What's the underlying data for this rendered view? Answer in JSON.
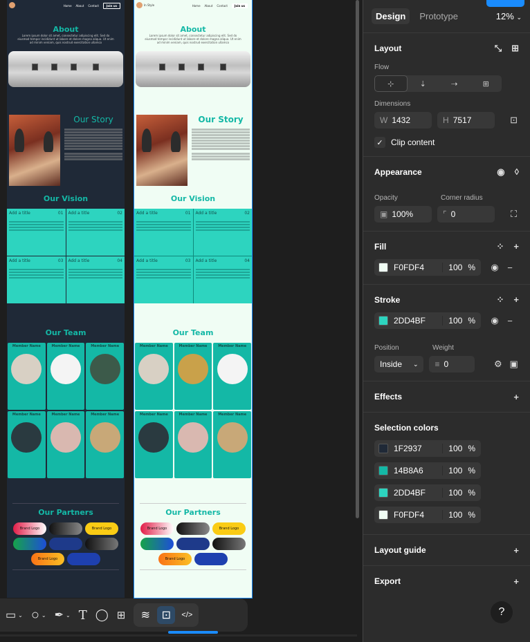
{
  "frames": [
    {
      "nav": [
        "Home",
        "About",
        "Contact"
      ],
      "join_label": "Join us",
      "about_title": "About",
      "about_text": "Lorem ipsum dolor sit amet, consectetur adipiscing elit. Sed do eiusmod tempor incididunt ut labore et dolore magna aliqua. Ut enim ad minim veniam, quis nostrud exercitation ullamco",
      "story_title": "Our Story",
      "vision_title": "Our Vision",
      "vision_cards": [
        {
          "title": "Add a title",
          "num": "01"
        },
        {
          "title": "Add a title",
          "num": "02"
        },
        {
          "title": "Add a title",
          "num": "03"
        },
        {
          "title": "Add a title",
          "num": "04"
        }
      ],
      "team_title": "Our Team",
      "member_name": "Member Name",
      "partners_title": "Our Partners",
      "brand_logo": "Brand Logo",
      "bg": "#1f2937"
    },
    {
      "brand": "In Style",
      "nav": [
        "Home",
        "About",
        "Contact"
      ],
      "join_label": "Join us",
      "about_title": "About",
      "about_text": "Lorem ipsum dolor sit amet, consectetur adipiscing elit. Sed do eiusmod tempor incididunt ut labore et dolore magna aliqua. Ut enim ad minim veniam, quis nostrud exercitation ullamco",
      "story_title": "Our Story",
      "vision_title": "Our Vision",
      "vision_cards": [
        {
          "title": "Add a title",
          "num": "01"
        },
        {
          "title": "Add a title",
          "num": "02"
        },
        {
          "title": "Add a title",
          "num": "03"
        },
        {
          "title": "Add a title",
          "num": "04"
        }
      ],
      "team_title": "Our Team",
      "member_name": "Member Name",
      "partners_title": "Our Partners",
      "brand_logo": "Brand Logo",
      "bg": "#f0fdf4"
    }
  ],
  "panel": {
    "tabs": [
      "Design",
      "Prototype"
    ],
    "active_tab": "Design",
    "zoom": "12%",
    "layout": {
      "title": "Layout",
      "flow_label": "Flow",
      "dimensions_label": "Dimensions",
      "w_key": "W",
      "w": "1432",
      "h_key": "H",
      "h": "7517",
      "clip_label": "Clip content",
      "clip_checked": true
    },
    "appearance": {
      "title": "Appearance",
      "opacity_label": "Opacity",
      "opacity": "100%",
      "radius_label": "Corner radius",
      "radius": "0"
    },
    "fill": {
      "title": "Fill",
      "hex": "F0FDF4",
      "opacity": "100",
      "pct": "%",
      "color": "#f0fdf4"
    },
    "stroke": {
      "title": "Stroke",
      "hex": "2DD4BF",
      "opacity": "100",
      "pct": "%",
      "color": "#2dd4bf",
      "position_label": "Position",
      "position": "Inside",
      "weight_label": "Weight",
      "weight": "0"
    },
    "effects_title": "Effects",
    "selection_colors": {
      "title": "Selection colors",
      "items": [
        {
          "hex": "1F2937",
          "opacity": "100",
          "color": "#1f2937"
        },
        {
          "hex": "14B8A6",
          "opacity": "100",
          "color": "#14b8a6"
        },
        {
          "hex": "2DD4BF",
          "opacity": "100",
          "color": "#2dd4bf"
        },
        {
          "hex": "F0FDF4",
          "opacity": "100",
          "color": "#f0fdf4"
        }
      ]
    },
    "layout_guide_title": "Layout guide",
    "export_title": "Export",
    "help": "?"
  },
  "toolbar": {
    "icons": [
      "frame-icon",
      "ellipse-icon",
      "pen-icon",
      "text-icon",
      "comment-icon",
      "actions-icon",
      "draw-icon",
      "design-mode-icon",
      "dev-mode-icon"
    ]
  }
}
